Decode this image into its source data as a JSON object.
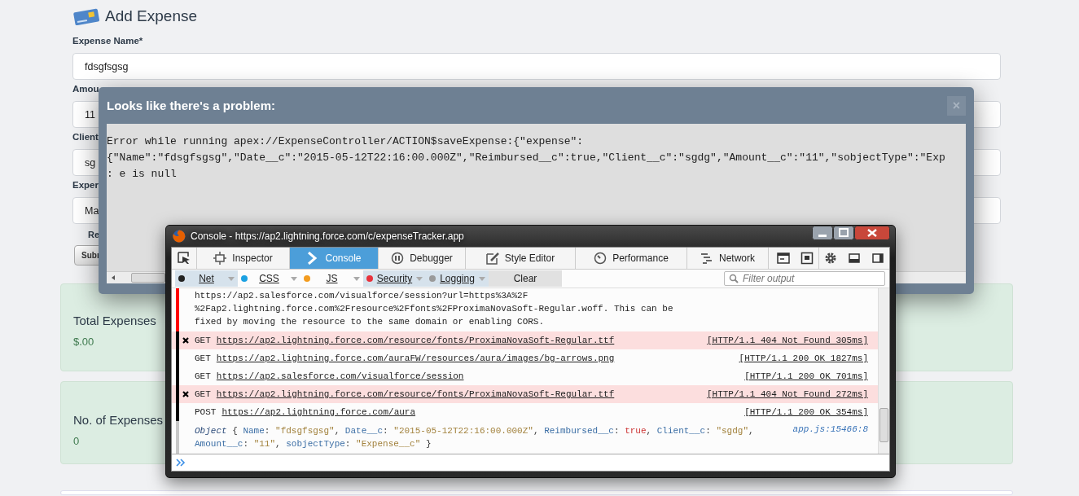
{
  "page": {
    "title": "Add Expense",
    "fields": [
      {
        "label": "Expense Name*",
        "value": "fdsgfsgsg"
      },
      {
        "label": "Amou",
        "value": "11"
      },
      {
        "label": "Client",
        "value": "sg"
      },
      {
        "label": "Exper",
        "value": "Ma"
      }
    ],
    "checkbox_label": "Re",
    "submit_button": "Subr",
    "cards": [
      {
        "title": "Total Expenses",
        "value": "$.00"
      },
      {
        "title": "No. of Expenses",
        "value": "0"
      }
    ]
  },
  "dialog": {
    "title": "Looks like there's a problem:",
    "close": "×",
    "message_lines": [
      "Error while running apex://ExpenseController/ACTION$saveExpense:{\"expense\":",
      "{\"Name\":\"fdsgfsgsg\",\"Date__c\":\"2015-05-12T22:16:00.000Z\",\"Reimbursed__c\":true,\"Client__c\":\"sgdg\",\"Amount__c\":\"11\",\"sobjectType\":\"Exp",
      ": e is null"
    ]
  },
  "console": {
    "window_title": "Console - https://ap2.lightning.force.com/c/expenseTracker.app",
    "tabs": [
      {
        "label": "Inspector",
        "kind": "inspector",
        "selected": false
      },
      {
        "label": "Console",
        "kind": "console",
        "selected": true
      },
      {
        "label": "Debugger",
        "kind": "debugger",
        "selected": false
      },
      {
        "label": "Style Editor",
        "kind": "editor",
        "selected": false
      },
      {
        "label": "Performance",
        "kind": "performance",
        "selected": false
      },
      {
        "label": "Network",
        "kind": "network",
        "selected": false
      }
    ],
    "filters": [
      {
        "label": "Net",
        "color": "#222222",
        "selected": true
      },
      {
        "label": "CSS",
        "color": "#1ba1e2",
        "selected": false
      },
      {
        "label": "JS",
        "color": "#f39c1f",
        "selected": false
      },
      {
        "label": "Security",
        "color": "#e8323c",
        "selected": true
      },
      {
        "label": "Logging",
        "color": "#9a9a9a",
        "selected": true
      }
    ],
    "clear_button": "Clear",
    "filter_placeholder": "Filter output",
    "entries": [
      {
        "kind": "message",
        "color": "#ff0000",
        "lines": [
          "https://ap2.salesforce.com/visualforce/session?url=https%3A%2F",
          "%2Fap2.lightning.force.com%2Fresource%2Ffonts%2FProximaNovaSoft-Regular.woff. This can be",
          "fixed by moving the resource to the same domain or enabling CORS."
        ]
      },
      {
        "kind": "request",
        "color": "#000000",
        "error": true,
        "method": "GET",
        "url": "https://ap2.lightning.force.com/resource/fonts/ProximaNovaSoft-Regular.ttf",
        "status": "[HTTP/1.1 404 Not Found 305ms]"
      },
      {
        "kind": "request",
        "color": "#000000",
        "error": false,
        "method": "GET",
        "url": "https://ap2.lightning.force.com/auraFW/resources/aura/images/bg-arrows.png",
        "status": "[HTTP/1.1 200 OK 1827ms]"
      },
      {
        "kind": "request",
        "color": "#000000",
        "error": false,
        "method": "GET",
        "url": "https://ap2.salesforce.com/visualforce/session",
        "status": "[HTTP/1.1 200 OK 701ms]"
      },
      {
        "kind": "request",
        "color": "#000000",
        "error": true,
        "method": "GET",
        "url": "https://ap2.lightning.force.com/resource/fonts/ProximaNovaSoft-Regular.ttf",
        "status": "[HTTP/1.1 404 Not Found 272ms]"
      },
      {
        "kind": "request",
        "color": "#000000",
        "error": false,
        "method": "POST",
        "url": "https://ap2.lightning.force.com/aura",
        "status": "[HTTP/1.1 200 OK 354ms]"
      },
      {
        "kind": "object",
        "color": "#c8c8c8",
        "source": "app.js:15466:8",
        "parts": [
          {
            "kind": "keyword",
            "text": "Object"
          },
          {
            "kind": "punct",
            "text": " { "
          },
          {
            "kind": "key",
            "text": "Name"
          },
          {
            "kind": "punct",
            "text": ": "
          },
          {
            "kind": "string",
            "text": "\"fdsgfsgsg\""
          },
          {
            "kind": "punct",
            "text": ", "
          },
          {
            "kind": "key",
            "text": "Date__c"
          },
          {
            "kind": "punct",
            "text": ": "
          },
          {
            "kind": "string",
            "text": "\"2015-05-12T22:16:00.000Z\""
          },
          {
            "kind": "punct",
            "text": ", "
          },
          {
            "kind": "key",
            "text": "Reimbursed__c"
          },
          {
            "kind": "punct",
            "text": ": "
          },
          {
            "kind": "bool",
            "text": "true"
          },
          {
            "kind": "punct",
            "text": ", "
          },
          {
            "kind": "key",
            "text": "Client__c"
          },
          {
            "kind": "punct",
            "text": ": "
          },
          {
            "kind": "string",
            "text": "\"sgdg\""
          },
          {
            "kind": "punct",
            "text": ", "
          },
          {
            "kind": "key",
            "text": "Amount__c"
          },
          {
            "kind": "punct",
            "text": ": "
          },
          {
            "kind": "string",
            "text": "\"11\""
          },
          {
            "kind": "punct",
            "text": ", "
          },
          {
            "kind": "key",
            "text": "sobjectType"
          },
          {
            "kind": "punct",
            "text": ": "
          },
          {
            "kind": "string",
            "text": "\"Expense__c\""
          },
          {
            "kind": "punct",
            "text": " }"
          }
        ]
      }
    ]
  }
}
